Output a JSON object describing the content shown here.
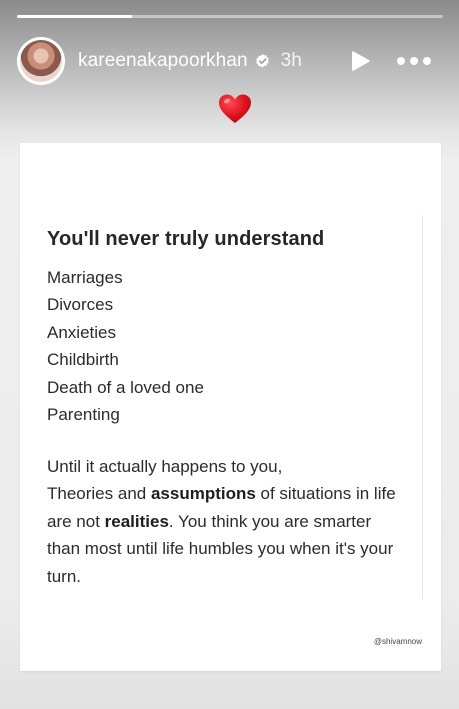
{
  "progress": {
    "value": 0.27
  },
  "header": {
    "username": "kareenakapoorkhan",
    "verified_icon": "verified-badge-icon",
    "time": "3h",
    "play_icon": "play-icon",
    "more_icon": "more-options-icon"
  },
  "sticker": {
    "icon": "red-heart-emoji"
  },
  "post": {
    "title": "You'll never truly understand",
    "items": [
      "Marriages",
      "Divorces",
      "Anxieties",
      "Childbirth",
      "Death of a loved one",
      "Parenting"
    ],
    "paragraph": {
      "line1": "Until it actually happens to you,",
      "seg1": "Theories and ",
      "bold1": "assumptions",
      "seg2": " of situations in life are not ",
      "bold2": "realities",
      "seg3": ". You think you are smarter than most until life humbles you when it's your turn."
    },
    "credit": "@shivamnow"
  },
  "colors": {
    "card_background": "#ffffff",
    "heart": "#e0131f",
    "text": "#2b2b2b"
  }
}
